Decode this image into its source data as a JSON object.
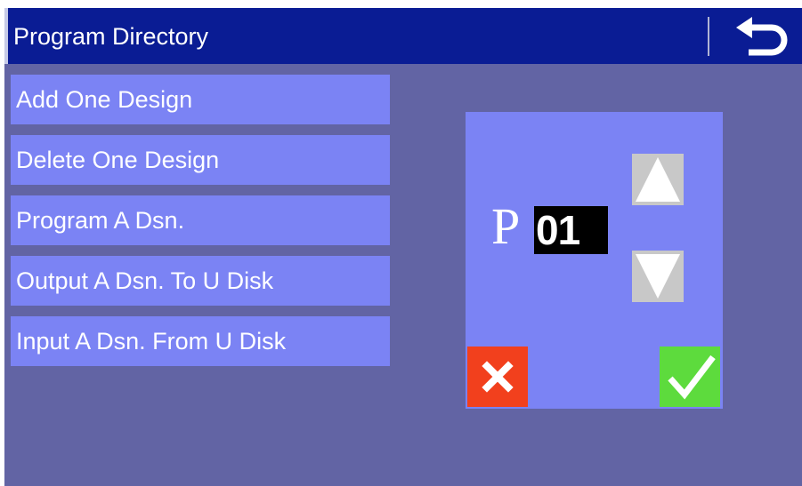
{
  "header": {
    "title": "Program Directory",
    "back_icon": "back-arrow-icon"
  },
  "menu": {
    "items": [
      {
        "label": "Add One Design"
      },
      {
        "label": "Delete One Design"
      },
      {
        "label": "Program A Dsn."
      },
      {
        "label": "Output A Dsn. To U Disk"
      },
      {
        "label": "Input A Dsn. From U Disk"
      }
    ]
  },
  "dialog": {
    "prefix": "P",
    "number": "01",
    "up_icon": "triangle-up-icon",
    "down_icon": "triangle-down-icon",
    "cancel_icon": "cross-icon",
    "confirm_icon": "check-icon"
  },
  "colors": {
    "background": "#6264a4",
    "title_bar": "#0a1c94",
    "menu_item": "#7b83f4",
    "cancel": "#f2401d",
    "confirm": "#5ddb3d"
  }
}
